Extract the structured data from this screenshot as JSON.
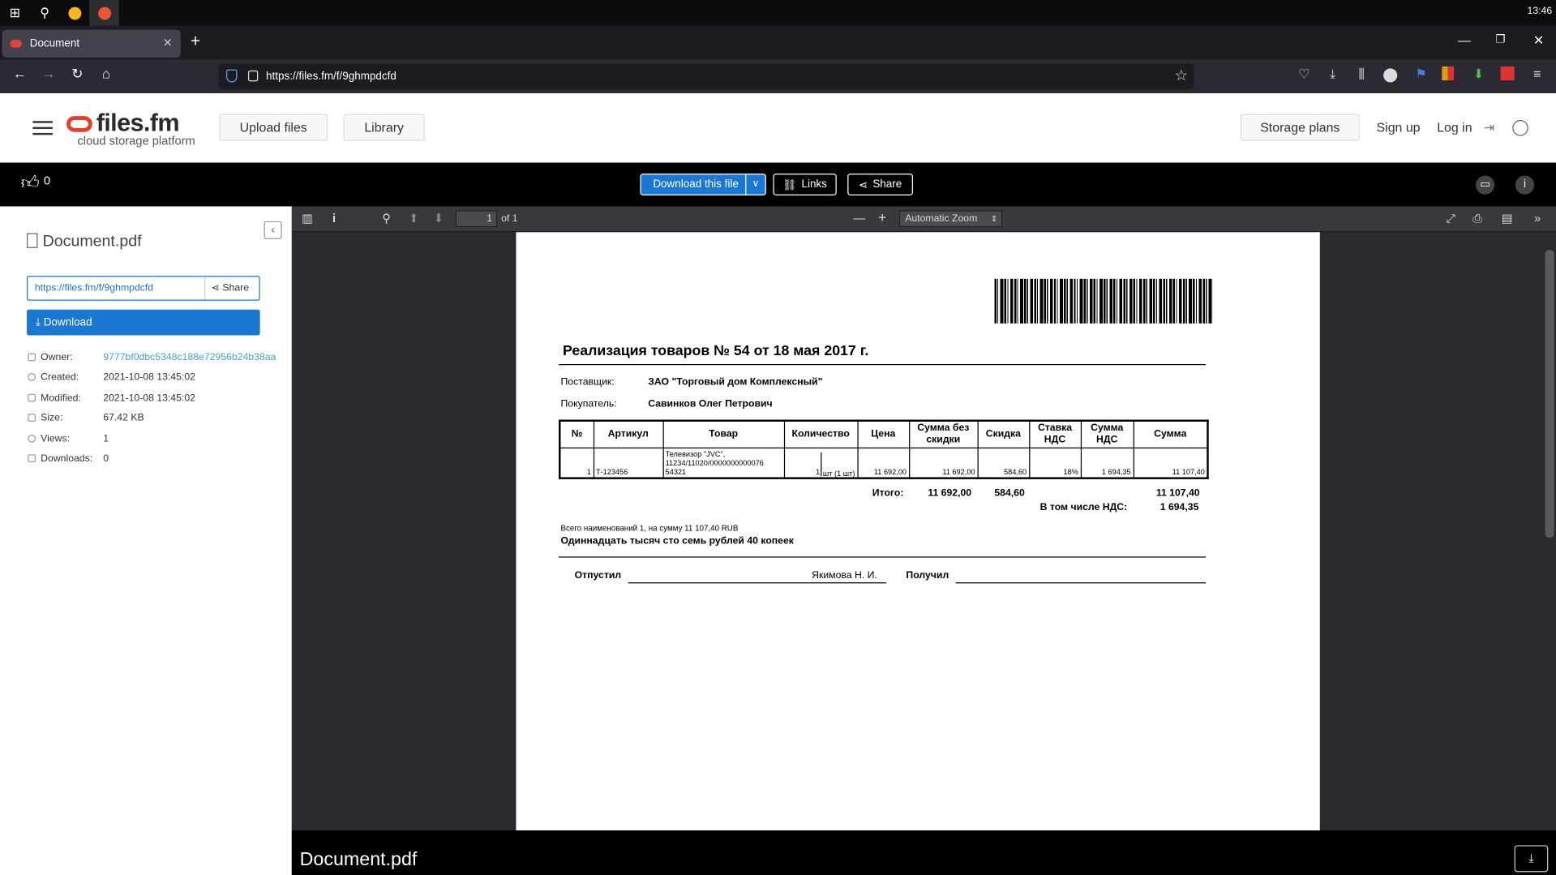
{
  "taskbar": {
    "clock": "13:46"
  },
  "browser": {
    "tab_title": "Document",
    "url": "https://files.fm/f/9ghmpdcfd"
  },
  "site": {
    "brand": "files.fm",
    "tagline": "cloud storage platform",
    "upload_label": "Upload files",
    "library_label": "Library",
    "storage_plans_label": "Storage plans",
    "signup_label": "Sign up",
    "login_label": "Log in"
  },
  "side": {
    "likes": "0",
    "file_name": "Document.pdf",
    "link": "https://files.fm/f/9ghmpdcfd",
    "share_label": "Share",
    "download_label": "Download",
    "meta": [
      {
        "k": "Owner:",
        "v": "9777bf0dbc5348c188e72956b24b38aa"
      },
      {
        "k": "Created:",
        "v": "2021-10-08 13:45:02"
      },
      {
        "k": "Modified:",
        "v": "2021-10-08 13:45:02"
      },
      {
        "k": "Size:",
        "v": "67.42 KB"
      },
      {
        "k": "Views:",
        "v": "1"
      },
      {
        "k": "Downloads:",
        "v": "0"
      }
    ]
  },
  "viewer": {
    "download_file_label": "Download this file",
    "links_label": "Links",
    "share_label": "Share",
    "page_number": "1",
    "page_of": "of 1",
    "zoom": "Automatic Zoom",
    "bottom_file_name": "Document.pdf"
  },
  "doc": {
    "title": "Реализация товаров № 54 от 18 мая 2017 г.",
    "supplier_label": "Поставщик:",
    "supplier": "ЗАО \"Торговый дом Комплексный\"",
    "buyer_label": "Покупатель:",
    "buyer": "Савинков Олег Петрович",
    "columns": [
      "№",
      "Артикул",
      "Товар",
      "Количество",
      "Цена",
      "Сумма без скидки",
      "Скидка",
      "Ставка НДС",
      "Сумма НДС",
      "Сумма"
    ],
    "row": {
      "num": "1",
      "article": "Т-123456",
      "item_line1": "Телевизор \"JVC\",",
      "item_line2": "11234/11020/0000000000076",
      "item_line3": "54321",
      "qty": "1",
      "unit": "шт (1 шт)",
      "price": "11 692,00",
      "sum_no_disc": "11 692,00",
      "discount": "584,60",
      "vat_rate": "18%",
      "vat_sum": "1 694,35",
      "sum": "11 107,40"
    },
    "total_label": "Итого:",
    "total_no_disc": "11 692,00",
    "total_discount": "584,60",
    "total_sum": "11 107,40",
    "vat_label": "В том числе НДС:",
    "vat_total": "1 694,35",
    "summary": "Всего наименований 1, на сумму 11 107,40 RUB",
    "words": "Одиннадцать тысяч сто семь рублей 40 копеек",
    "released_label": "Отпустил",
    "released_name": "Якимова Н. И.",
    "received_label": "Получил"
  }
}
